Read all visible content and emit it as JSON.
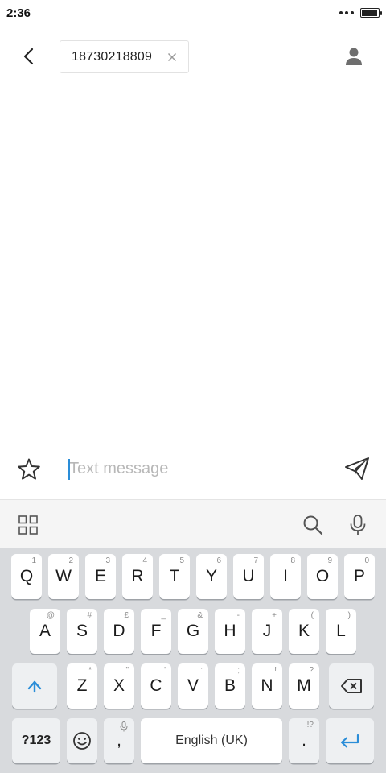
{
  "status_bar": {
    "time": "2:36",
    "battery_level": 0.95
  },
  "header": {
    "recipient_number": "18730218809"
  },
  "compose": {
    "placeholder": "Text message",
    "value": ""
  },
  "keyboard": {
    "row1": [
      {
        "label": "Q",
        "hint": "1"
      },
      {
        "label": "W",
        "hint": "2"
      },
      {
        "label": "E",
        "hint": "3"
      },
      {
        "label": "R",
        "hint": "4"
      },
      {
        "label": "T",
        "hint": "5"
      },
      {
        "label": "Y",
        "hint": "6"
      },
      {
        "label": "U",
        "hint": "7"
      },
      {
        "label": "I",
        "hint": "8"
      },
      {
        "label": "O",
        "hint": "9"
      },
      {
        "label": "P",
        "hint": "0"
      }
    ],
    "row2": [
      {
        "label": "A",
        "hint": "@"
      },
      {
        "label": "S",
        "hint": "#"
      },
      {
        "label": "D",
        "hint": "£"
      },
      {
        "label": "F",
        "hint": "_"
      },
      {
        "label": "G",
        "hint": "&"
      },
      {
        "label": "H",
        "hint": "-"
      },
      {
        "label": "J",
        "hint": "+"
      },
      {
        "label": "K",
        "hint": "("
      },
      {
        "label": "L",
        "hint": ")"
      }
    ],
    "row3": [
      {
        "label": "Z",
        "hint": "*"
      },
      {
        "label": "X",
        "hint": "\""
      },
      {
        "label": "C",
        "hint": "'"
      },
      {
        "label": "V",
        "hint": ":"
      },
      {
        "label": "B",
        "hint": ";"
      },
      {
        "label": "N",
        "hint": "!"
      },
      {
        "label": "M",
        "hint": "?"
      }
    ],
    "symbols_label": "?123",
    "comma_label": ",",
    "space_label": "English (UK)",
    "period_label": ".",
    "period_hint": "!?"
  },
  "colors": {
    "accent": "#2a8dd8",
    "input_underline": "#f29a74",
    "keyboard_bg": "#d8dadd",
    "toolbar_bg": "#f5f5f5"
  },
  "icons": {
    "status": [
      "more-dots-icon",
      "battery-icon"
    ],
    "header": [
      "back-arrow-icon",
      "close-icon",
      "person-icon"
    ],
    "compose": [
      "star-icon",
      "send-icon"
    ],
    "toolbar": [
      "grid-icon",
      "search-icon",
      "microphone-icon"
    ],
    "keyboard": [
      "shift-arrow-icon",
      "backspace-icon",
      "emoji-icon",
      "enter-arrow-icon"
    ]
  }
}
